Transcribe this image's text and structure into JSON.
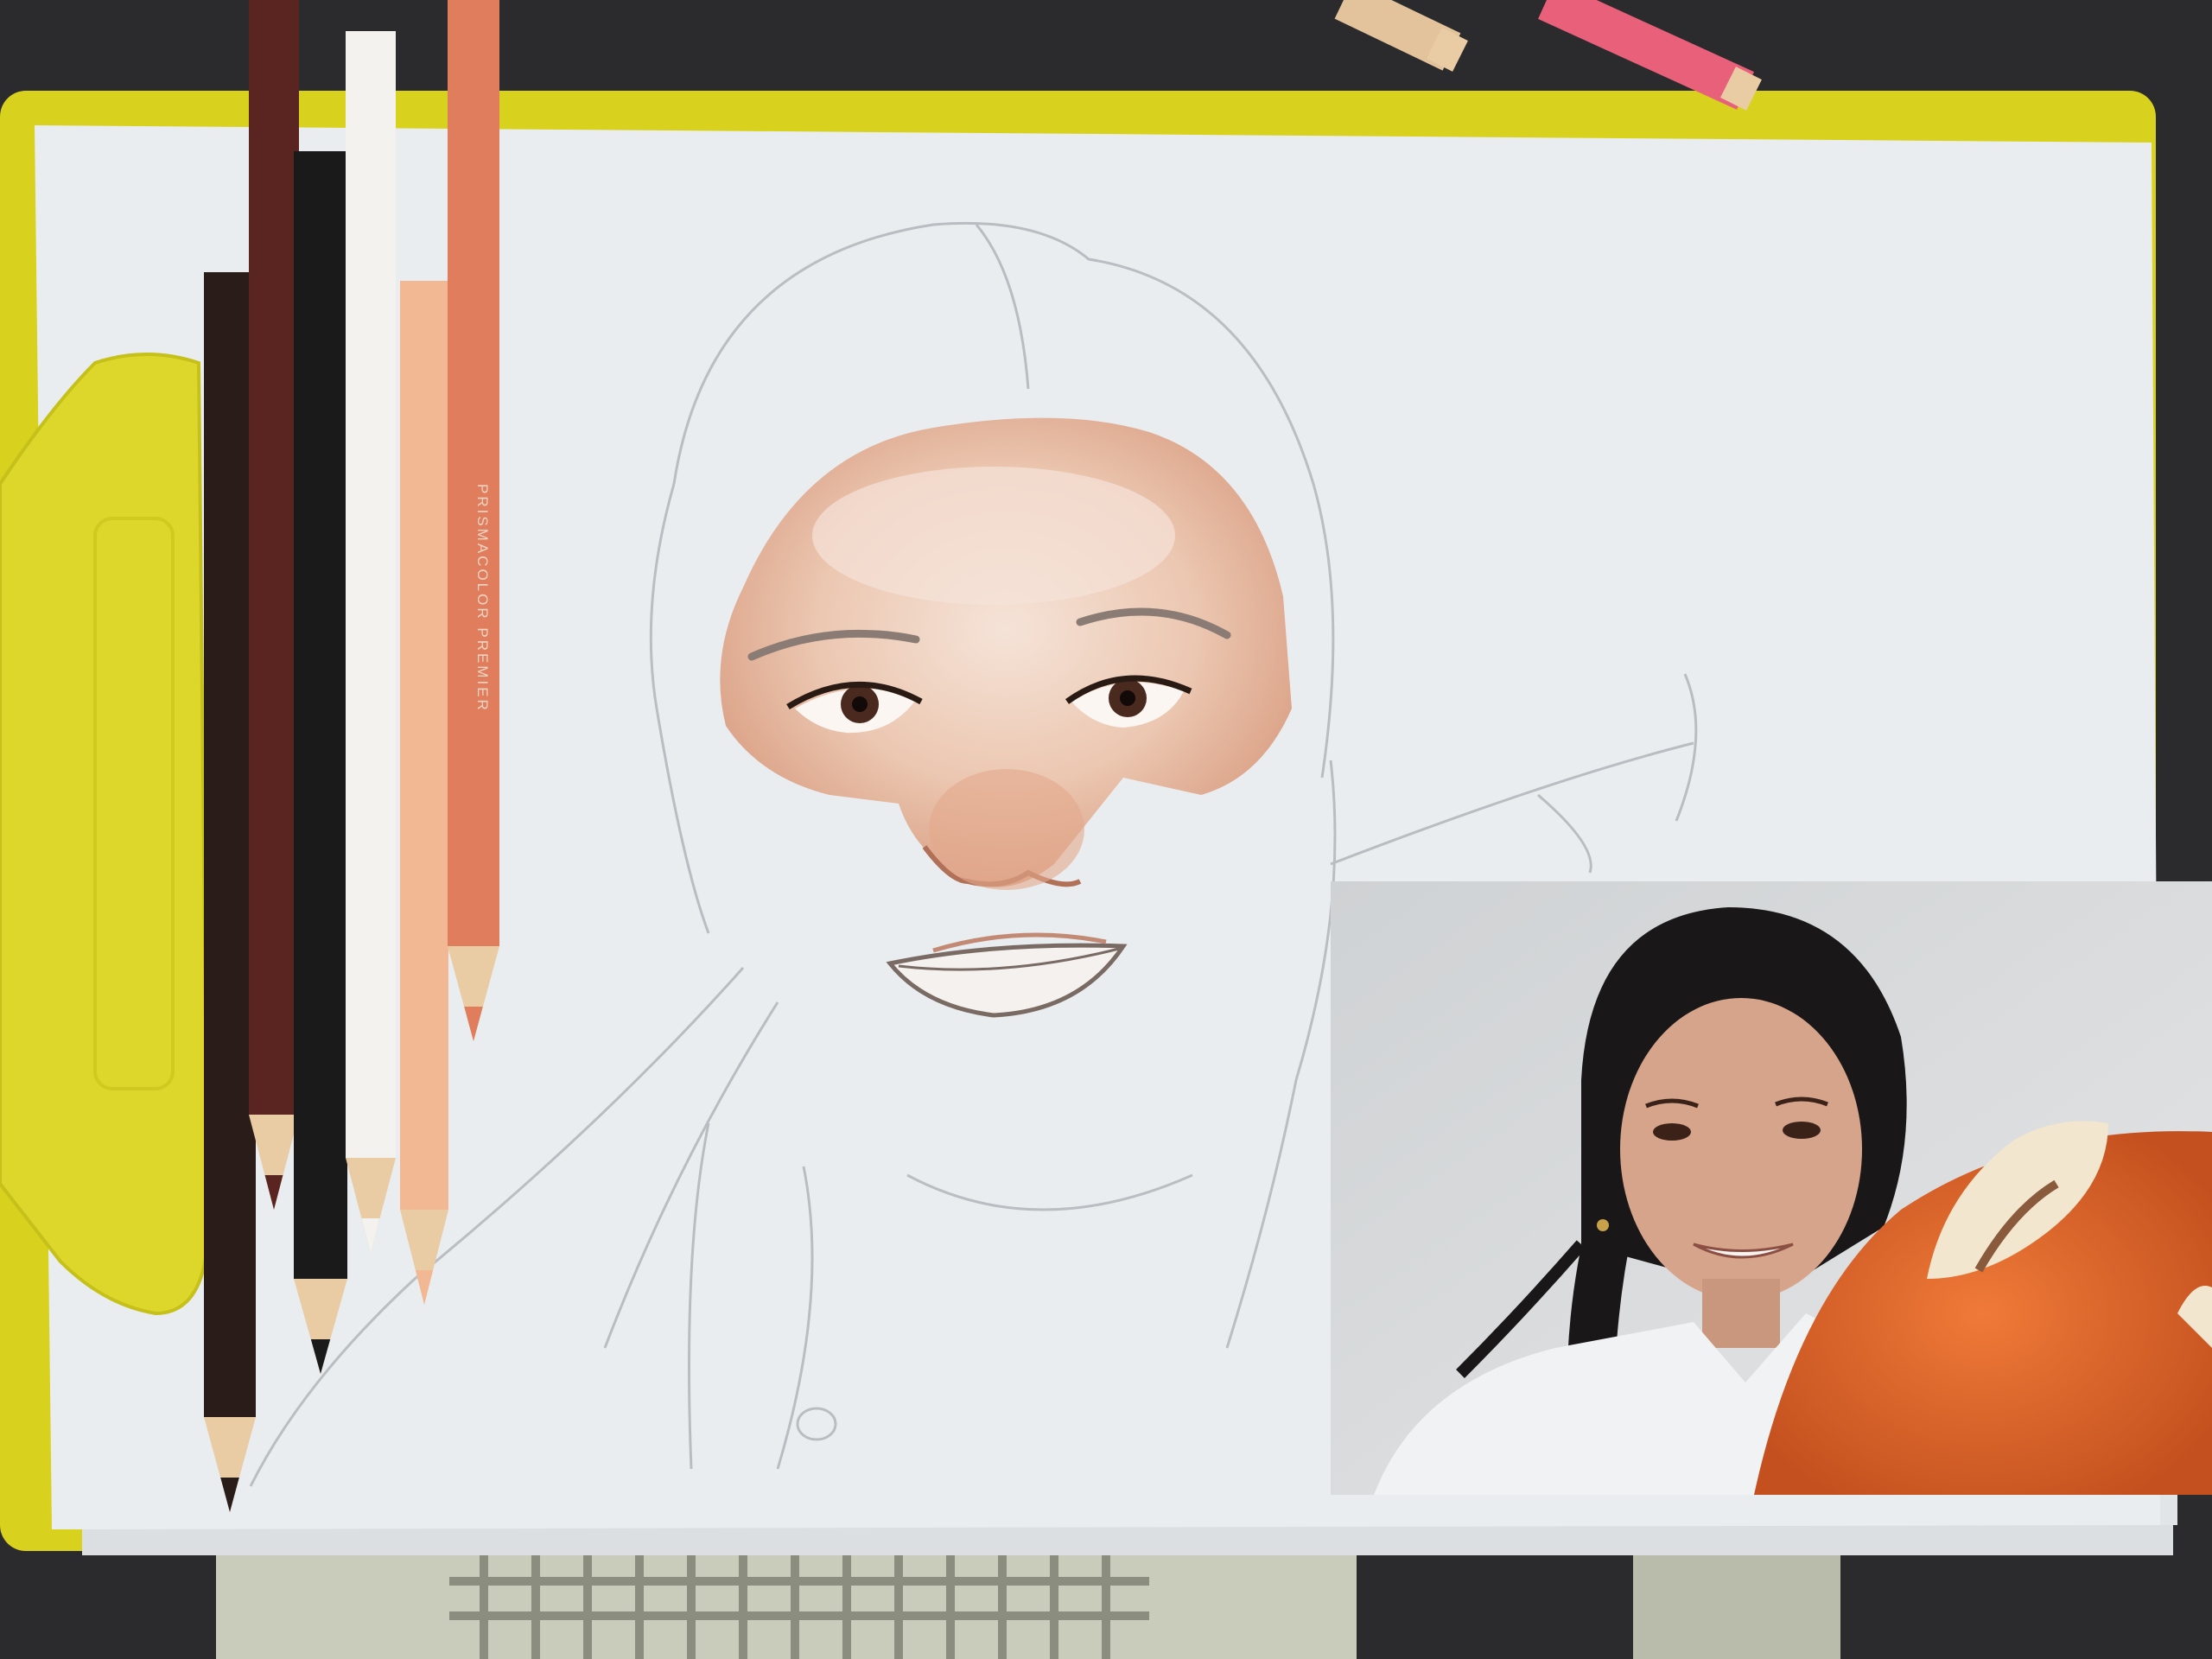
{
  "scene": {
    "subject": "colored-pencil portrait drawing in progress beside a reference photograph",
    "colors": {
      "table": "#2b2a2c",
      "clipboard": "#d8d11e",
      "paper": "#eaedf0",
      "skin_tone": "#e7b59a",
      "photo_background": "#d6d7d9"
    }
  },
  "pencils": {
    "label_text": "PRISMACOLOR PREMIER",
    "colors": [
      {
        "name": "black-brown",
        "hex": "#2a1c18"
      },
      {
        "name": "dark-brown",
        "hex": "#5a2420"
      },
      {
        "name": "black",
        "hex": "#1b1a1a"
      },
      {
        "name": "white",
        "hex": "#f4f2ee"
      },
      {
        "name": "peach",
        "hex": "#f2b894"
      },
      {
        "name": "terra-cotta",
        "hex": "#e07d5c"
      },
      {
        "name": "beige",
        "hex": "#e3c39c"
      },
      {
        "name": "pink",
        "hex": "#e9607a"
      }
    ]
  }
}
